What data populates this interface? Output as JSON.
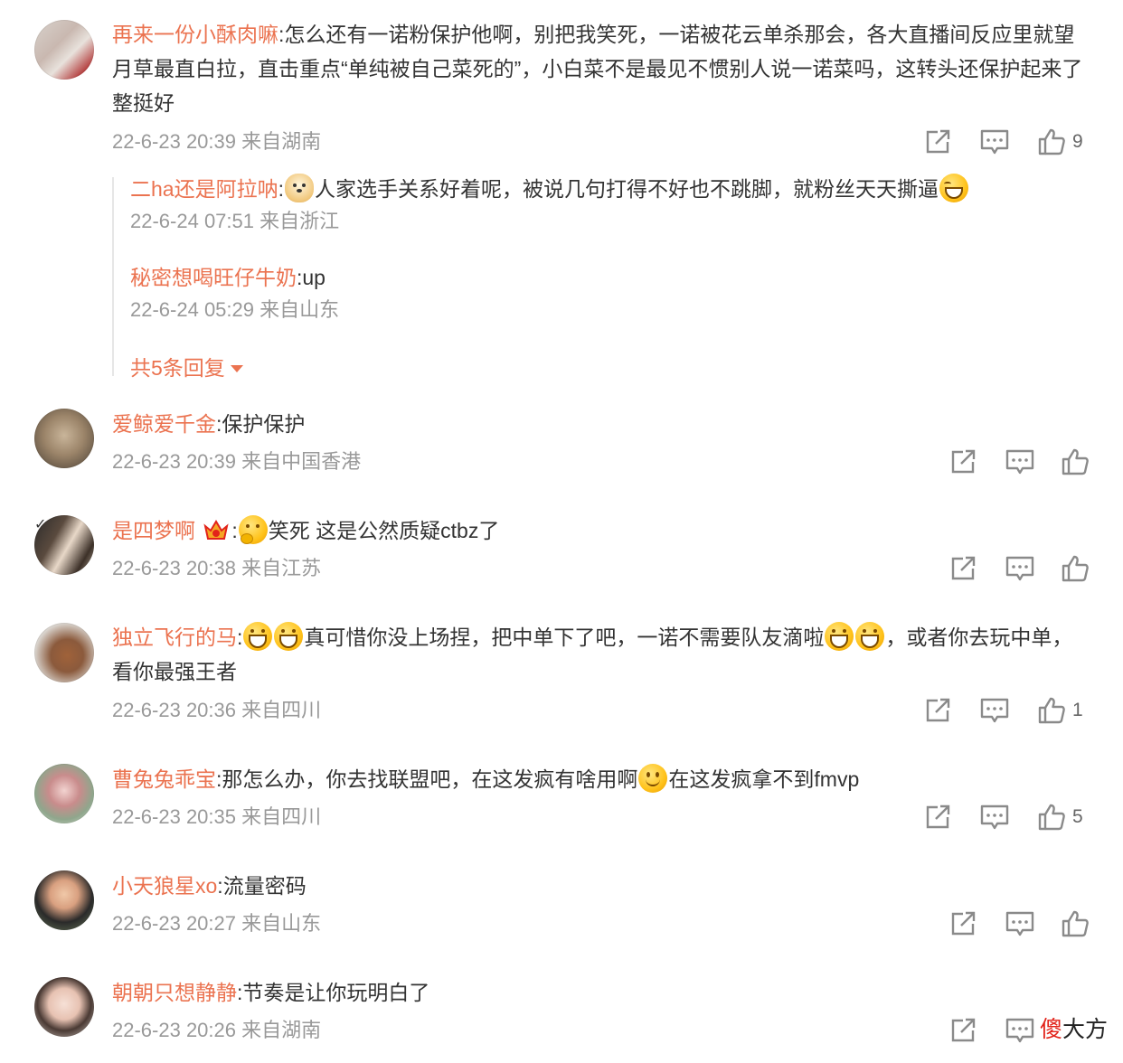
{
  "comments": [
    {
      "user": "再来一份小酥肉嘛",
      "text": "怎么还有一诺粉保护他啊，别把我笑死，一诺被花云单杀那会，各大直播间反应里就望月草最直白拉，直击重点“单纯被自己菜死的”，小白菜不是最见不惯别人说一诺菜吗，这转头还保护起来了整挺好",
      "meta": "22-6-23 20:39 来自湖南",
      "likes": "9",
      "replies": [
        {
          "user": "二ha还是阿拉呐",
          "text": "人家选手关系好着呢，被说几句打得不好也不跳脚，就粉丝天天撕逼",
          "meta": "22-6-24 07:51 来自浙江"
        },
        {
          "user": "秘密想喝旺仔牛奶",
          "text": "up",
          "meta": "22-6-24 05:29 来自山东"
        }
      ],
      "more_replies": "共5条回复"
    },
    {
      "user": "爱鲸爱千金",
      "text": "保护保护",
      "meta": "22-6-23 20:39 来自中国香港",
      "likes": ""
    },
    {
      "user": "是四梦啊",
      "text": "笑死 这是公然质疑ctbz了",
      "meta": "22-6-23 20:38 来自江苏",
      "likes": ""
    },
    {
      "user": "独立飞行的马",
      "text_a": "真可惜你没上场捏，把中单下了吧，一诺不需要队友滴啦",
      "text_b": "，或者你去玩中单，看你最强王者",
      "meta": "22-6-23 20:36 来自四川",
      "likes": "1"
    },
    {
      "user": "曹兔兔乖宝",
      "text_a": "那怎么办，你去找联盟吧，在这发疯有啥用啊",
      "text_b": "在这发疯拿不到fmvp",
      "meta": "22-6-23 20:35 来自四川",
      "likes": "5"
    },
    {
      "user": "小天狼星xo",
      "text": "流量密码",
      "meta": "22-6-23 20:27 来自山东",
      "likes": ""
    },
    {
      "user": "朝朝只想静静",
      "text": "节奏是让你玩明白了",
      "meta": "22-6-23 20:26 来自湖南",
      "likes": ""
    }
  ],
  "colon": ":",
  "watermark": {
    "part1": "傻",
    "part2": "大方"
  },
  "colors": {
    "username": "#eb7350",
    "meta": "#999999",
    "icon": "#8a8a8a",
    "text": "#333333"
  },
  "icons": [
    "share-icon",
    "comment-icon",
    "like-icon"
  ]
}
